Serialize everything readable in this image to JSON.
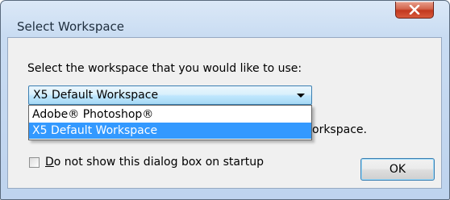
{
  "window": {
    "title": "Select Workspace",
    "close_icon": "close-x-icon"
  },
  "dialog": {
    "prompt": "Select the workspace that you would like to use:",
    "combo": {
      "selected": "X5 Default Workspace",
      "arrow_icon": "chevron-down-icon"
    },
    "dropdown": {
      "options": [
        {
          "label": "Adobe® Photoshop®",
          "selected": false
        },
        {
          "label": "X5 Default Workspace",
          "selected": true
        }
      ]
    },
    "behind_text": "orkspace.",
    "checkbox": {
      "label": "Do not show this dialog box on startup",
      "checked": false
    },
    "ok_label": "OK"
  },
  "colors": {
    "selection": "#3399ff",
    "close_button": "#c2381e"
  }
}
